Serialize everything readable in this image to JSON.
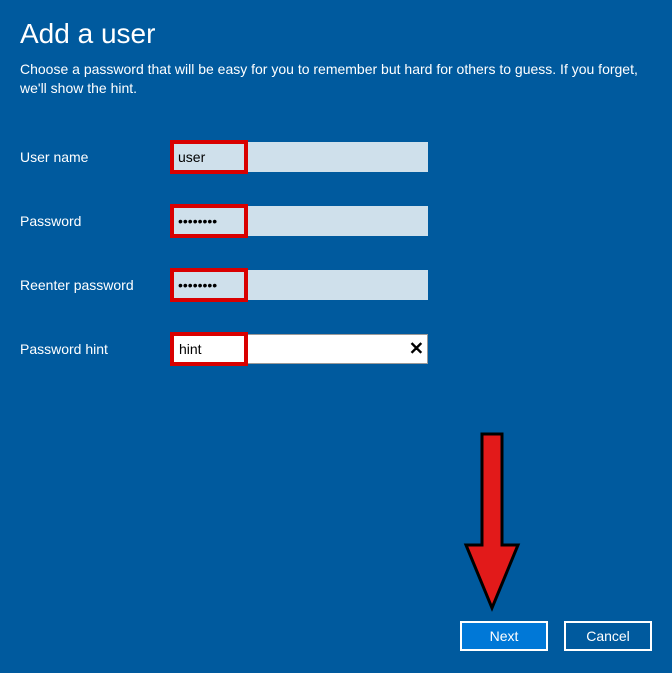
{
  "title": "Add a user",
  "subtitle": "Choose a password that will be easy for you to remember but hard for others to guess. If you forget, we'll show the hint.",
  "fields": {
    "username": {
      "label": "User name",
      "value": "user"
    },
    "password": {
      "label": "Password",
      "value": "••••••••"
    },
    "reenter": {
      "label": "Reenter password",
      "value": "••••••••"
    },
    "hint": {
      "label": "Password hint",
      "value": "hint"
    }
  },
  "buttons": {
    "next": "Next",
    "cancel": "Cancel"
  }
}
